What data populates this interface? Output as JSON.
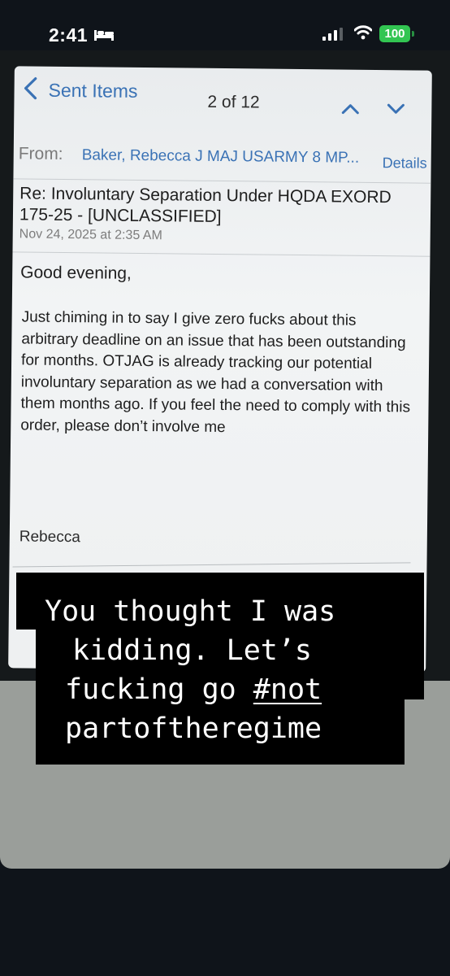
{
  "status_bar": {
    "time": "2:41",
    "battery": "100",
    "battery_color": "#32c552"
  },
  "email": {
    "back_label": "Sent Items",
    "page_count": "2 of 12",
    "from_label": "From:",
    "from_value": "Baker, Rebecca J MAJ USARMY 8 MP...",
    "details_label": "Details",
    "subject": "Re: Involuntary Separation Under HQDA EXORD 175-25 - [UNCLASSIFIED]",
    "date": "Nov 24, 2025 at 2:35 AM",
    "greeting": "Good evening,",
    "body": "Just chiming in to say I give zero fucks about this arbitrary deadline on an issue that has been outstanding for months. OTJAG is already tracking our potential involuntary separation as we had a conversation with them months ago. If you feel the need to comply with this order, please don’t involve me",
    "signature": "Rebecca",
    "link_color": "#3a72b5"
  },
  "caption": {
    "line1": "You thought I was",
    "line2": "kidding. Let’s",
    "line3_text": "fucking go ",
    "line3_tag": "#not",
    "line4": "partoftheregime"
  }
}
